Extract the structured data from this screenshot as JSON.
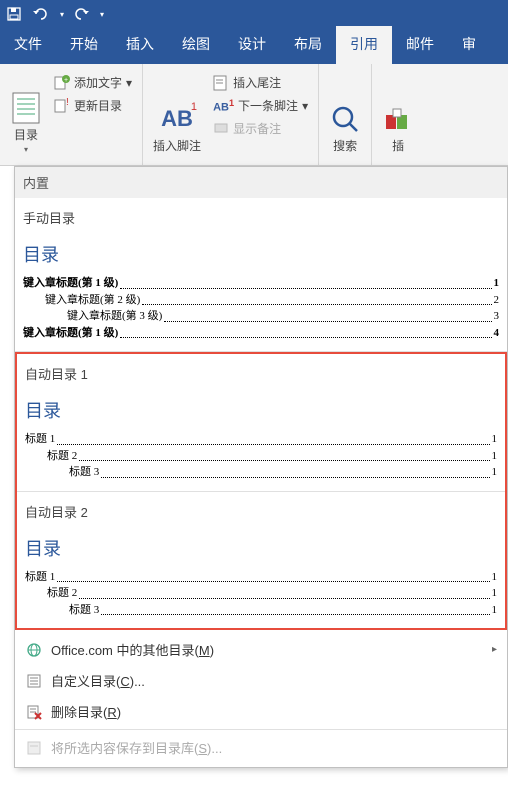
{
  "qat": {
    "save": "save",
    "undo": "undo",
    "redo": "redo"
  },
  "tabs": [
    "文件",
    "开始",
    "插入",
    "绘图",
    "设计",
    "布局",
    "引用",
    "邮件",
    "审"
  ],
  "active_tab": "引用",
  "ribbon": {
    "toc_btn": "目录",
    "add_text": "添加文字",
    "update_toc": "更新目录",
    "insert_footnote": "插入脚注",
    "insert_endnote": "插入尾注",
    "next_footnote": "下一条脚注",
    "show_notes": "显示备注",
    "search": "搜索",
    "insert_trunc": "插"
  },
  "dropdown": {
    "builtin": "内置",
    "manual": {
      "title": "手动目录",
      "heading": "目录",
      "lines": [
        {
          "text": "键入章标题(第 1 级)",
          "page": "1",
          "indent": 0,
          "bold": true
        },
        {
          "text": "键入章标题(第 2 级)",
          "page": "2",
          "indent": 1,
          "bold": false
        },
        {
          "text": "键入章标题(第 3 级)",
          "page": "3",
          "indent": 2,
          "bold": false
        },
        {
          "text": "键入章标题(第 1 级)",
          "page": "4",
          "indent": 0,
          "bold": true
        }
      ]
    },
    "auto1": {
      "title": "自动目录 1",
      "heading": "目录",
      "lines": [
        {
          "text": "标题 1",
          "page": "1",
          "indent": 0,
          "bold": false
        },
        {
          "text": "标题 2",
          "page": "1",
          "indent": 1,
          "bold": false
        },
        {
          "text": "标题 3",
          "page": "1",
          "indent": 2,
          "bold": false
        }
      ]
    },
    "auto2": {
      "title": "自动目录 2",
      "heading": "目录",
      "lines": [
        {
          "text": "标题 1",
          "page": "1",
          "indent": 0,
          "bold": false
        },
        {
          "text": "标题 2",
          "page": "1",
          "indent": 1,
          "bold": false
        },
        {
          "text": "标题 3",
          "page": "1",
          "indent": 2,
          "bold": false
        }
      ]
    },
    "menu": {
      "office_more_pre": "Office.com 中的其他目录(",
      "office_more_k": "M",
      "office_more_post": ")",
      "custom_pre": "自定义目录(",
      "custom_k": "C",
      "custom_post": ")...",
      "remove_pre": "删除目录(",
      "remove_k": "R",
      "remove_post": ")",
      "save_pre": "将所选内容保存到目录库(",
      "save_k": "S",
      "save_post": ")..."
    }
  }
}
